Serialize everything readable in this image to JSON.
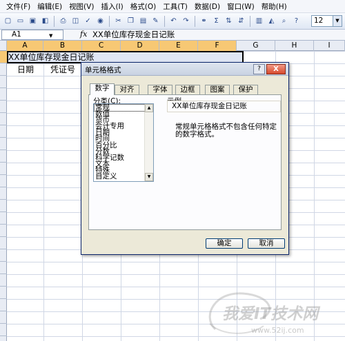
{
  "menubar": {
    "items": [
      "文件(F)",
      "编辑(E)",
      "视图(V)",
      "插入(I)",
      "格式(O)",
      "工具(T)",
      "数据(D)",
      "窗口(W)",
      "帮助(H)"
    ]
  },
  "toolbar": {
    "font_size": "12",
    "icons": [
      "new-icon",
      "open-icon",
      "save-icon",
      "permission-icon",
      "print-icon",
      "print-preview-icon",
      "spelling-icon",
      "research-icon",
      "cut-icon",
      "copy-icon",
      "paste-icon",
      "format-painter-icon",
      "undo-icon",
      "redo-icon",
      "hyperlink-icon",
      "autosum-icon",
      "sort-ascending-icon",
      "sort-descending-icon",
      "chart-wizard-icon",
      "drawing-icon",
      "zoom-icon",
      "help-icon"
    ]
  },
  "formula_bar": {
    "name_box": "A1",
    "fx": "fx",
    "content": "XX单位库存现金日记账"
  },
  "grid": {
    "columns": [
      "A",
      "B",
      "C",
      "D",
      "E",
      "F",
      "G",
      "H",
      "I"
    ],
    "cells": {
      "title": "XX单位库存现金日记账",
      "date": "日期",
      "voucher": "凭证号"
    }
  },
  "dialog": {
    "title": "单元格格式",
    "help": "?",
    "close": "X",
    "tabs": [
      "数字",
      "对齐",
      "字体",
      "边框",
      "图案",
      "保护"
    ],
    "active_tab": "数字",
    "category_label": "分类(C):",
    "categories": [
      "常规",
      "数值",
      "货币",
      "会计专用",
      "日期",
      "时间",
      "百分比",
      "分数",
      "科学记数",
      "文本",
      "特殊",
      "自定义"
    ],
    "selected_category": "常规",
    "sample_label": "示例",
    "sample_value": "XX单位库存现金日记账",
    "description": "常规单元格格式不包含任何特定的数字格式。",
    "ok": "确定",
    "cancel": "取消"
  },
  "watermark": {
    "text": "我爱IT技术网",
    "url": "www.52ij.com"
  },
  "colors": {
    "selected_header": "#f7c874",
    "dialog_bg": "#ece9d8",
    "close_button": "#d6482c",
    "selection_fill": "#dfe6f4"
  }
}
